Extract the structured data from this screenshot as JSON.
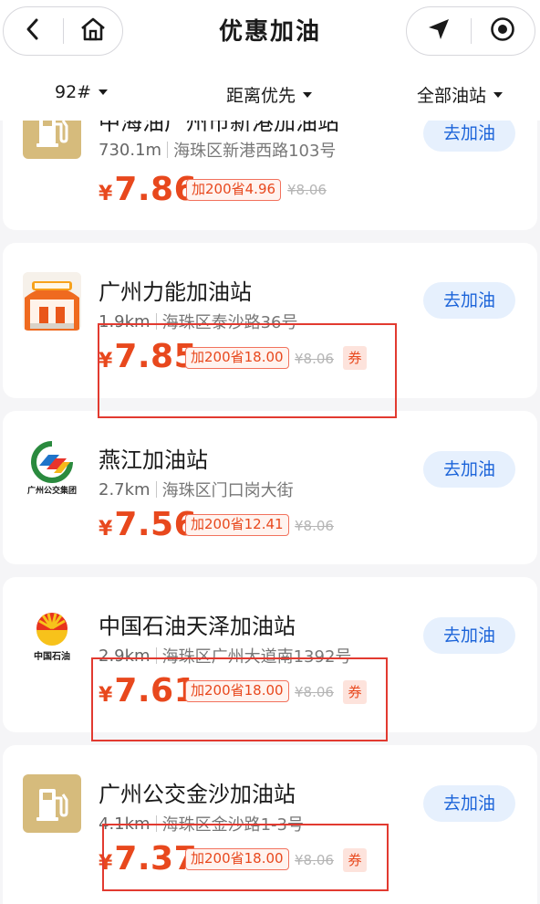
{
  "nav": {
    "title": "优惠加油",
    "back_icon": "back-arrow-icon",
    "home_icon": "home-icon",
    "locate_icon": "location-arrow-icon",
    "record_icon": "target-circle-icon"
  },
  "filters": {
    "fuel": "92#",
    "sort": "距离优先",
    "station_type": "全部油站"
  },
  "stations": [
    {
      "name": "中海油广州市新港加油站",
      "distance": "730.1m",
      "address": "海珠区新港西路103号",
      "currency": "¥",
      "price": "7.86",
      "discount": "加200省4.96",
      "original_price": "¥8.06",
      "coupon": "",
      "button": "去加油",
      "logo_icon": "fuel-pump-icon"
    },
    {
      "name": "广州力能加油站",
      "distance": "1.9km",
      "address": "海珠区泰沙路36号",
      "currency": "¥",
      "price": "7.85",
      "discount": "加200省18.00",
      "original_price": "¥8.06",
      "coupon": "券",
      "button": "去加油",
      "logo_icon": "gas-station-photo-icon"
    },
    {
      "name": "燕江加油站",
      "distance": "2.7km",
      "address": "海珠区门口岗大街",
      "currency": "¥",
      "price": "7.56",
      "discount": "加200省12.41",
      "original_price": "¥8.06",
      "coupon": "",
      "button": "去加油",
      "logo_icon": "guangzhou-transport-group-logo-icon",
      "logo_text": "广州公交集团"
    },
    {
      "name": "中国石油天泽加油站",
      "distance": "2.9km",
      "address": "海珠区广州大道南1392号",
      "currency": "¥",
      "price": "7.61",
      "discount": "加200省18.00",
      "original_price": "¥8.06",
      "coupon": "券",
      "button": "去加油",
      "logo_icon": "petrochina-logo-icon",
      "logo_text": "中国石油"
    },
    {
      "name": "广州公交金沙加油站",
      "distance": "4.1km",
      "address": "海珠区金沙路1-3号",
      "currency": "¥",
      "price": "7.37",
      "discount": "加200省18.00",
      "original_price": "¥8.06",
      "coupon": "券",
      "button": "去加油",
      "logo_icon": "fuel-pump-icon"
    }
  ],
  "colors": {
    "accent_price": "#e8481d",
    "button_bg": "#e6f0fd",
    "button_text": "#1c64d9",
    "highlight": "#e23a30"
  }
}
